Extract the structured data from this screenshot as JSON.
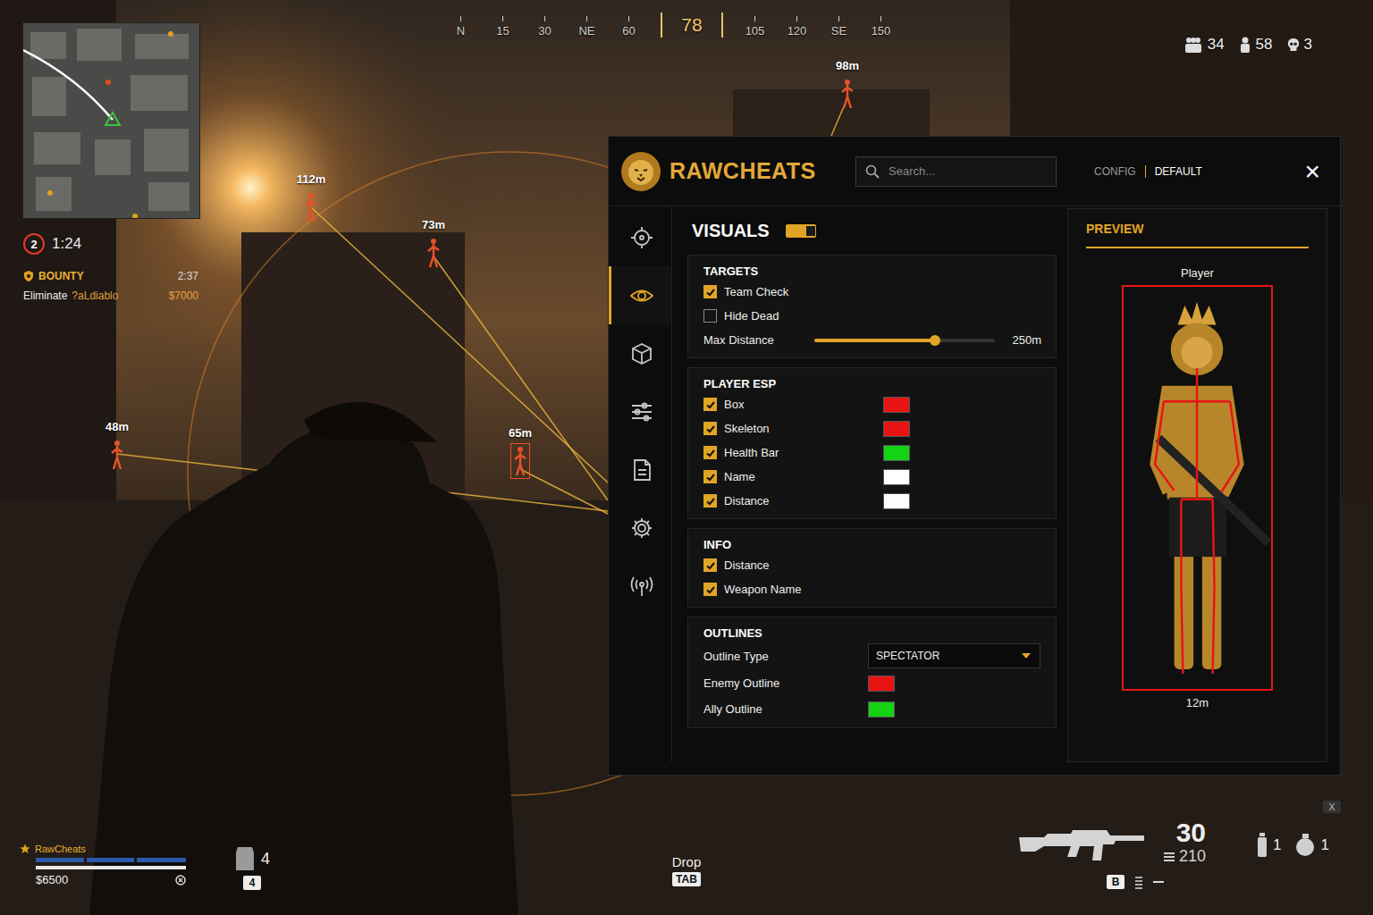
{
  "hud": {
    "compass": [
      {
        "label": "N",
        "selected": false
      },
      {
        "label": "15",
        "selected": false
      },
      {
        "label": "30",
        "selected": false
      },
      {
        "label": "NE",
        "selected": false
      },
      {
        "label": "60",
        "selected": false
      },
      {
        "label": "78",
        "selected": true
      },
      {
        "label": "105",
        "selected": false
      },
      {
        "label": "120",
        "selected": false
      },
      {
        "label": "SE",
        "selected": false
      },
      {
        "label": "150",
        "selected": false
      }
    ],
    "counts": [
      "34",
      "58",
      "3"
    ],
    "zone": {
      "number": "2",
      "time": "1:24"
    },
    "bounty": {
      "title": "BOUNTY",
      "time": "2:37",
      "text": "Eliminate",
      "target": "?aLdiablo",
      "reward": "$7000"
    },
    "markers": [
      {
        "distance": "98m",
        "boxed": false
      },
      {
        "distance": "112m",
        "boxed": false
      },
      {
        "distance": "73m",
        "boxed": false
      },
      {
        "distance": "65m",
        "boxed": true
      },
      {
        "distance": "48m",
        "boxed": false
      }
    ],
    "player": {
      "name": "RawCheats",
      "armor": 1,
      "health": 1,
      "money": "$6500"
    },
    "plates": {
      "count": "4",
      "key": "4"
    },
    "drop": {
      "label": "Drop",
      "key": "TAB"
    },
    "weapon": {
      "ammo": "30",
      "reserve": "210",
      "key": "B"
    },
    "equipment": [
      "1",
      "1"
    ],
    "close_key": "X"
  },
  "menu": {
    "brand": "RAWCHEATS",
    "search": {
      "placeholder": "Search..."
    },
    "config": {
      "label": "CONFIG",
      "value": "DEFAULT"
    },
    "close": "×",
    "nav": [
      {
        "selected": false
      },
      {
        "selected": true
      },
      {
        "selected": false
      },
      {
        "selected": false
      },
      {
        "selected": false
      },
      {
        "selected": false
      },
      {
        "selected": false
      }
    ],
    "section": {
      "title": "VISUALS",
      "enabled": true
    },
    "groups": [
      {
        "title": "TARGETS",
        "rows": [
          {
            "kind": "checkbox",
            "label": "Team Check",
            "checked": true
          },
          {
            "kind": "checkbox",
            "label": "Hide Dead",
            "checked": false
          },
          {
            "kind": "slider",
            "label": "Max Distance",
            "level": 0.67,
            "reading": "250m"
          }
        ]
      },
      {
        "title": "PLAYER ESP",
        "rows": [
          {
            "kind": "color",
            "label": "Box",
            "checked": true,
            "color": "#e81414"
          },
          {
            "kind": "color",
            "label": "Skeleton",
            "checked": true,
            "color": "#e81414"
          },
          {
            "kind": "color",
            "label": "Health Bar",
            "checked": true,
            "color": "#14d214"
          },
          {
            "kind": "color",
            "label": "Name",
            "checked": true,
            "color": "#ffffff"
          },
          {
            "kind": "color",
            "label": "Distance",
            "checked": true,
            "color": "#ffffff"
          }
        ]
      },
      {
        "title": "INFO",
        "rows": [
          {
            "kind": "checkbox",
            "label": "Distance",
            "checked": true
          },
          {
            "kind": "checkbox",
            "label": "Weapon Name",
            "checked": true
          }
        ]
      },
      {
        "title": "OUTLINES",
        "rows": [
          {
            "kind": "select",
            "label": "Outline Type",
            "value": "SPECTATOR"
          },
          {
            "kind": "swatch",
            "label": "Enemy Outline",
            "color": "#e81414"
          },
          {
            "kind": "swatch",
            "label": "Ally Outline",
            "color": "#14d214"
          }
        ]
      }
    ],
    "preview": {
      "title": "PREVIEW",
      "label": "Player",
      "distance": "12m"
    }
  }
}
